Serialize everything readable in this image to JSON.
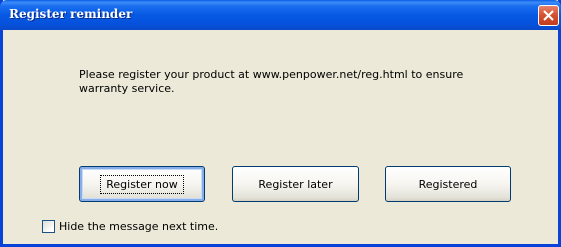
{
  "window": {
    "title": "Register reminder",
    "close_icon": "close-icon"
  },
  "message": {
    "line1": "Please register your product at www.penpower.net/reg.html to ensure",
    "line2": "warranty service."
  },
  "buttons": {
    "register_now": "Register now",
    "register_later": "Register later",
    "registered": "Registered"
  },
  "checkbox": {
    "label": "Hide the message next time.",
    "checked": false
  },
  "colors": {
    "titlebar": "#0659e3",
    "dialog_bg": "#ece9d8",
    "close_button": "#d4502f"
  }
}
